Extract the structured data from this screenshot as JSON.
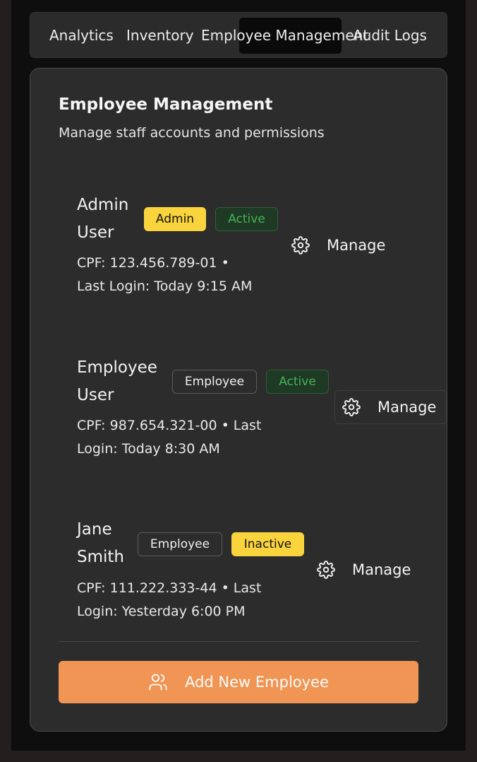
{
  "tabs": [
    {
      "label": "Analytics",
      "active": false
    },
    {
      "label": "Inventory",
      "active": false
    },
    {
      "label": "Employee Management",
      "active": true
    },
    {
      "label": "Audit Logs",
      "active": false
    }
  ],
  "panel": {
    "title": "Employee Management",
    "subtitle": "Manage staff accounts and permissions"
  },
  "employees": [
    {
      "name_line1": "Admin",
      "name_line2": "User",
      "role": "Admin",
      "status": "Active",
      "meta_line1": "CPF: 123.456.789-01 •",
      "meta_line2": "Last Login: Today 9:15 AM",
      "action": "Manage"
    },
    {
      "name_line1": "Employee",
      "name_line2": "User",
      "role": "Employee",
      "status": "Active",
      "meta_line1": "CPF: 987.654.321-00 • Last",
      "meta_line2": "Login: Today 8:30 AM",
      "action": "Manage"
    },
    {
      "name_line1": "Jane",
      "name_line2": "Smith",
      "role": "Employee",
      "status": "Inactive",
      "meta_line1": "CPF: 111.222.333-44 • Last",
      "meta_line2": "Login: Yesterday 6:00 PM",
      "action": "Manage"
    }
  ],
  "add_button": {
    "label": "Add New Employee",
    "icon": "users-icon"
  },
  "colors": {
    "accent": "#f09553",
    "admin_badge": "#fad43c",
    "active_badge_text": "#48b058",
    "inactive_badge": "#fad43c"
  }
}
